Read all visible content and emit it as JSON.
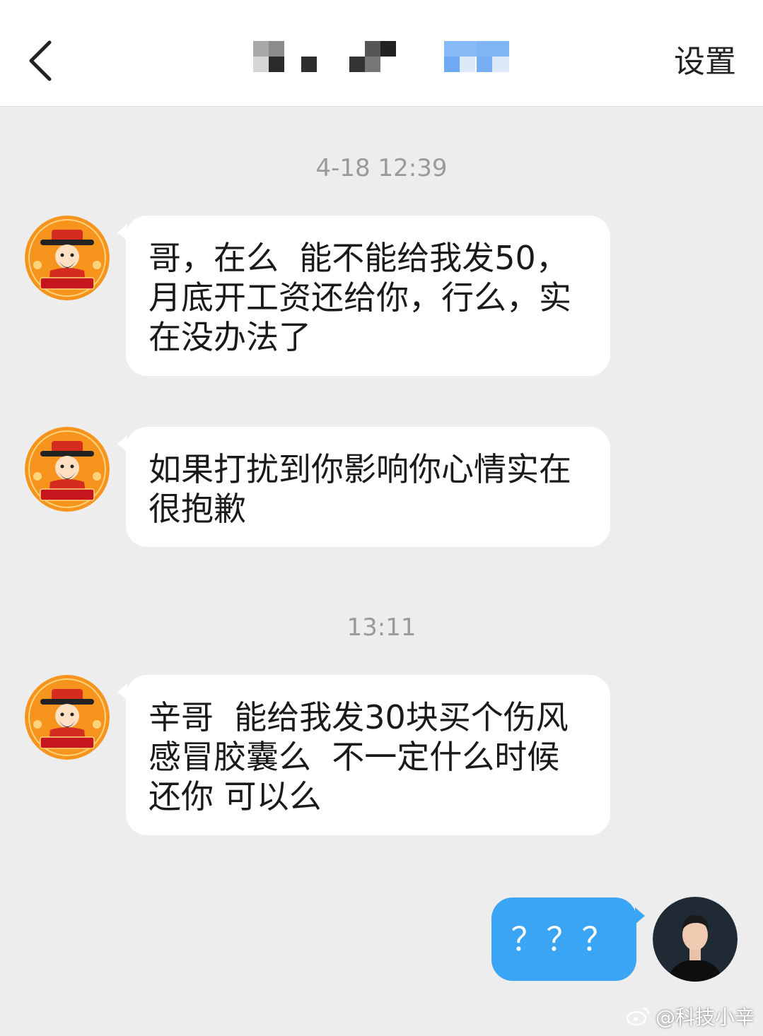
{
  "header": {
    "settings_label": "设置"
  },
  "conversation": [
    {
      "type": "timestamp",
      "text": "4-18 12:39"
    },
    {
      "type": "message",
      "sender": "contact",
      "text": "哥，在么  能不能给我发50，\n月底开工资还给你，行么，实\n在没办法了"
    },
    {
      "type": "message",
      "sender": "contact",
      "text": "如果打扰到你影响你心情实在\n很抱歉"
    },
    {
      "type": "timestamp",
      "text": "13:11"
    },
    {
      "type": "message",
      "sender": "contact",
      "text": "辛哥  能给我发30块买个伤风\n感冒胶囊么  不一定什么时候\n还你 可以么"
    },
    {
      "type": "message",
      "sender": "me",
      "text": "？？？"
    }
  ],
  "contact_avatar_label": "招财進寶",
  "watermark": "@科技小辛",
  "colors": {
    "background": "#ededed",
    "incoming_bubble": "#ffffff",
    "outgoing_bubble": "#3ba5f5",
    "avatar_bg": "#f6941e"
  }
}
